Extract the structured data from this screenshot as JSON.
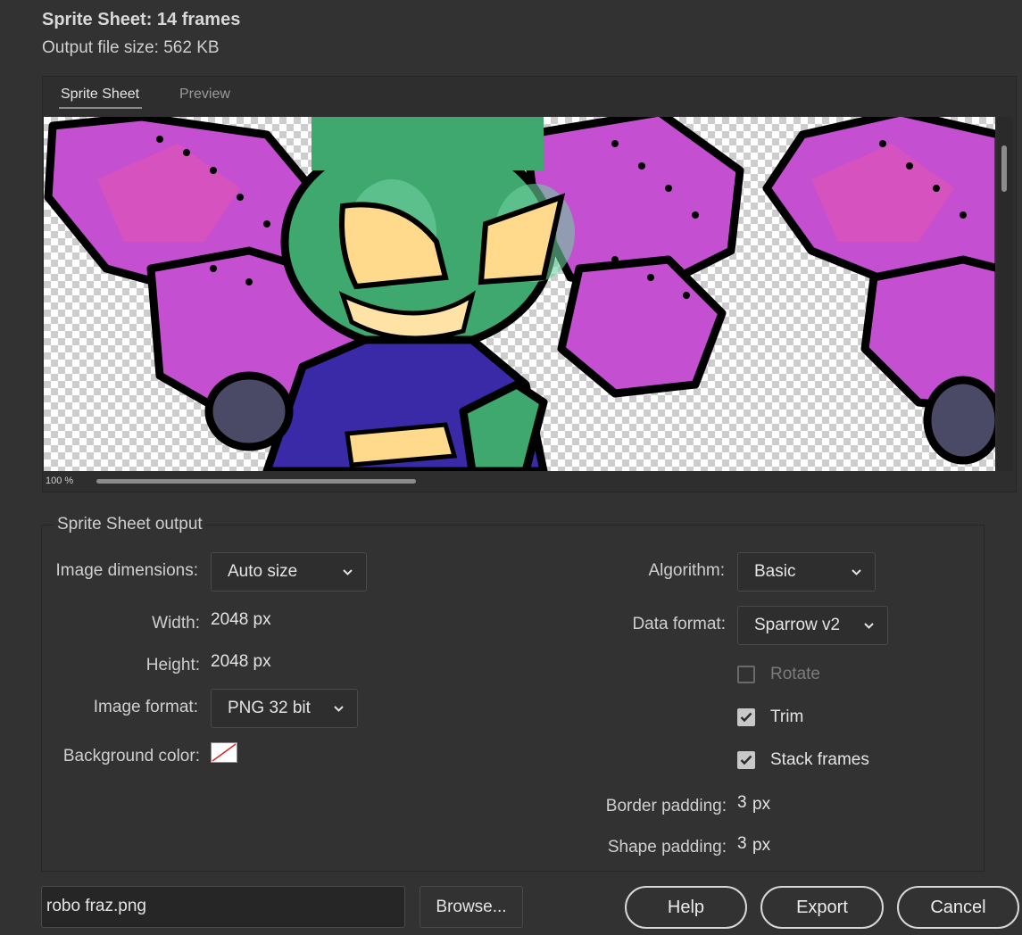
{
  "header": {
    "title": "Sprite Sheet: 14 frames",
    "file_size": "Output file size: 562 KB"
  },
  "tabs": [
    {
      "label": "Sprite Sheet",
      "active": true
    },
    {
      "label": "Preview",
      "active": false
    }
  ],
  "preview": {
    "zoom": "100 %"
  },
  "output": {
    "group_title": "Sprite Sheet output",
    "image_dimensions_label": "Image dimensions:",
    "image_dimensions_value": "Auto size",
    "width_label": "Width:",
    "width_value": "2048 px",
    "height_label": "Height:",
    "height_value": "2048 px",
    "image_format_label": "Image format:",
    "image_format_value": "PNG 32 bit",
    "background_color_label": "Background color:",
    "background_color_value": "none",
    "algorithm_label": "Algorithm:",
    "algorithm_value": "Basic",
    "data_format_label": "Data format:",
    "data_format_value": "Sparrow v2",
    "rotate_label": "Rotate",
    "rotate_checked": false,
    "trim_label": "Trim",
    "trim_checked": true,
    "stack_frames_label": "Stack frames",
    "stack_frames_checked": true,
    "border_padding_label": "Border padding:",
    "border_padding_value": "3",
    "border_padding_unit": "px",
    "shape_padding_label": "Shape padding:",
    "shape_padding_value": "3",
    "shape_padding_unit": "px"
  },
  "footer": {
    "filename": "robo fraz.png",
    "browse_label": "Browse...",
    "help_label": "Help",
    "export_label": "Export",
    "cancel_label": "Cancel"
  },
  "colors": {
    "dialog_bg": "#323232",
    "flower_petal": "#c44fd0",
    "character_green": "#3ea86f",
    "eye_yellow": "#ffd98c",
    "jacket_blue": "#3a2aa8"
  }
}
